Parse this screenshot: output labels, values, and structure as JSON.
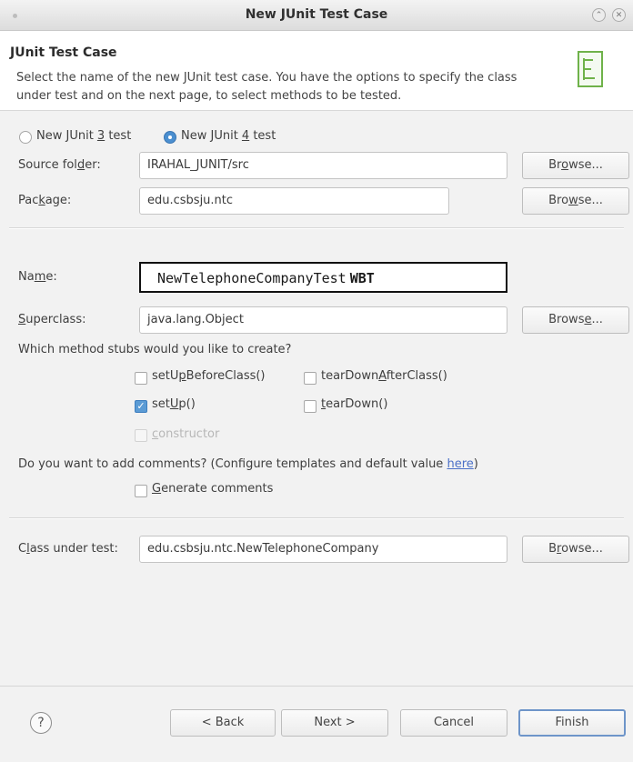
{
  "window": {
    "title": "New JUnit Test Case",
    "minimize_glyph": "⌃",
    "close_glyph": "✕"
  },
  "header": {
    "title": "JUnit Test Case",
    "description": "Select the name of the new JUnit test case. You have the options to specify the class under test and on the next page, to select methods to be tested.",
    "icon": "junit-wizard-icon"
  },
  "junit_version": {
    "options": [
      {
        "label_pre": "New JUnit ",
        "mnemonic": "3",
        "label_post": " test",
        "selected": false
      },
      {
        "label_pre": "New JUnit ",
        "mnemonic": "4",
        "label_post": " test",
        "selected": true
      }
    ]
  },
  "source_folder": {
    "label_pre": "Source fol",
    "mnemonic": "d",
    "label_post": "er:",
    "value": "IRAHAL_JUNIT/src",
    "browse": {
      "pre": "Br",
      "mn": "o",
      "post": "wse..."
    }
  },
  "package": {
    "label_pre": "Pac",
    "mnemonic": "k",
    "label_post": "age:",
    "value": "edu.csbsju.ntc",
    "browse": {
      "pre": "Bro",
      "mn": "w",
      "post": "se..."
    }
  },
  "name": {
    "label_pre": "Na",
    "mnemonic": "m",
    "label_post": "e:",
    "value": "NewTelephoneCompanyTest",
    "value_suffix": "WBT"
  },
  "superclass": {
    "label_pre": "",
    "mnemonic": "S",
    "label_post": "uperclass:",
    "value": "java.lang.Object",
    "browse": {
      "pre": "Brows",
      "mn": "e",
      "post": "..."
    }
  },
  "stubs": {
    "question": "Which method stubs would you like to create?",
    "items": [
      {
        "pre": "setU",
        "mn": "p",
        "post": "BeforeClass()",
        "checked": false,
        "enabled": true
      },
      {
        "pre": "tearDown",
        "mn": "A",
        "post": "fterClass()",
        "checked": false,
        "enabled": true
      },
      {
        "pre": "set",
        "mn": "U",
        "post": "p()",
        "checked": true,
        "enabled": true
      },
      {
        "pre": "",
        "mn": "t",
        "post": "earDown()",
        "checked": false,
        "enabled": true
      },
      {
        "pre": "",
        "mn": "c",
        "post": "onstructor",
        "checked": false,
        "enabled": false
      }
    ]
  },
  "comments": {
    "question_pre": "Do you want to add comments? (Configure templates and default value ",
    "link": "here",
    "question_post": ")",
    "checkbox": {
      "pre": "",
      "mn": "G",
      "post": "enerate comments",
      "checked": false
    }
  },
  "class_under_test": {
    "label_pre": "C",
    "mnemonic": "l",
    "label_post": "ass under test:",
    "value": "edu.csbsju.ntc.NewTelephoneCompany",
    "browse": {
      "pre": "B",
      "mn": "r",
      "post": "owse..."
    }
  },
  "footer": {
    "help": "?",
    "back": "< Back",
    "next": "Next >",
    "cancel": "Cancel",
    "finish": "Finish"
  }
}
